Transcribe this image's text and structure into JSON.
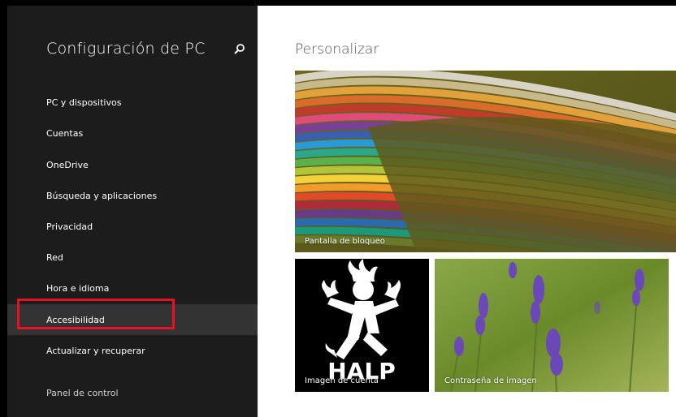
{
  "sidebar": {
    "title": "Configuración de PC",
    "search_icon": "search-icon",
    "items": [
      {
        "label": "PC y dispositivos",
        "selected": false
      },
      {
        "label": "Cuentas",
        "selected": false
      },
      {
        "label": "OneDrive",
        "selected": false
      },
      {
        "label": "Búsqueda y aplicaciones",
        "selected": false
      },
      {
        "label": "Privacidad",
        "selected": false
      },
      {
        "label": "Red",
        "selected": false
      },
      {
        "label": "Hora e idioma",
        "selected": false
      },
      {
        "label": "Accesibilidad",
        "selected": true
      },
      {
        "label": "Actualizar y recuperar",
        "selected": false
      }
    ],
    "footer_link": "Panel de control",
    "highlight_color": "#e81123"
  },
  "main": {
    "title": "Personalizar",
    "tiles": {
      "lock_screen": "Pantalla de bloqueo",
      "account_picture": "Imagen de cuenta",
      "picture_password": "Contraseña de imagen"
    },
    "account_image_text": "HALP"
  },
  "colors": {
    "sidebar_bg": "#1c1c1c",
    "selected_bg": "#333333",
    "main_bg": "#ffffff"
  }
}
